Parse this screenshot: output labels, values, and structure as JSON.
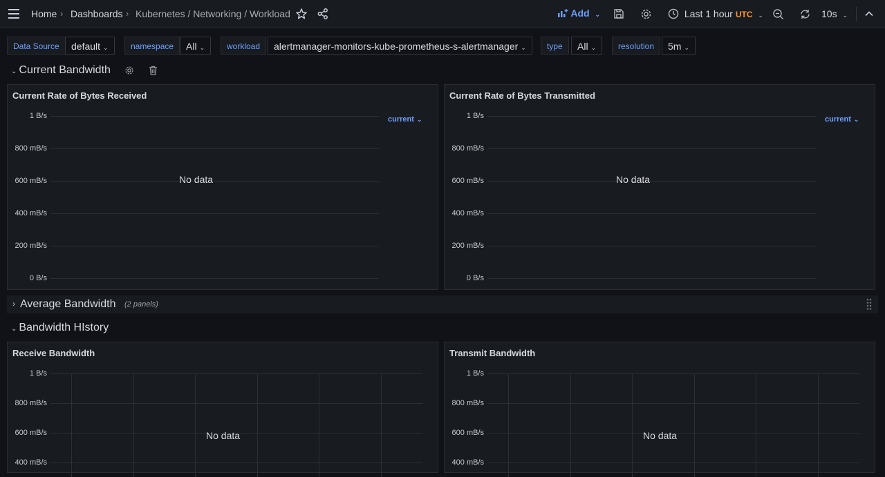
{
  "breadcrumb": {
    "home": "Home",
    "dashboards": "Dashboards",
    "current": "Kubernetes / Networking / Workload",
    "separator": "›"
  },
  "toolbar": {
    "add_label": "Add",
    "time_range": "Last 1 hour",
    "timezone": "UTC",
    "refresh_interval": "10s"
  },
  "variables": [
    {
      "label": "Data Source",
      "value": "default"
    },
    {
      "label": "namespace",
      "value": "All"
    },
    {
      "label": "workload",
      "value": "alertmanager-monitors-kube-prometheus-s-alertmanager"
    },
    {
      "label": "type",
      "value": "All"
    },
    {
      "label": "resolution",
      "value": "5m"
    }
  ],
  "rows": {
    "current_bandwidth": {
      "title": "Current Bandwidth"
    },
    "average_bandwidth": {
      "title": "Average Bandwidth",
      "meta": "(2 panels)"
    },
    "bandwidth_history": {
      "title": "Bandwidth HIstory"
    }
  },
  "panels": {
    "received": {
      "title": "Current Rate of Bytes Received",
      "legend": "current",
      "no_data": "No data",
      "ticks": [
        "1 B/s",
        "800 mB/s",
        "600 mB/s",
        "400 mB/s",
        "200 mB/s",
        "0 B/s"
      ]
    },
    "transmitted": {
      "title": "Current Rate of Bytes Transmitted",
      "legend": "current",
      "no_data": "No data",
      "ticks": [
        "1 B/s",
        "800 mB/s",
        "600 mB/s",
        "400 mB/s",
        "200 mB/s",
        "0 B/s"
      ]
    },
    "receive_bw": {
      "title": "Receive Bandwidth",
      "no_data": "No data",
      "ticks": [
        "1 B/s",
        "800 mB/s",
        "600 mB/s",
        "400 mB/s"
      ]
    },
    "transmit_bw": {
      "title": "Transmit Bandwidth",
      "no_data": "No data",
      "ticks": [
        "1 B/s",
        "800 mB/s",
        "600 mB/s",
        "400 mB/s"
      ]
    }
  },
  "colors": {
    "accent": "#6e9fff",
    "utc": "#ff9830",
    "background": "#111217",
    "panel": "#181b1f"
  },
  "icons": [
    "menu-icon",
    "star-icon",
    "share-icon",
    "add-panel-icon",
    "save-icon",
    "gear-icon",
    "clock-icon",
    "zoom-out-icon",
    "refresh-icon",
    "collapse-icon",
    "trash-icon",
    "drag-handle-icon"
  ]
}
